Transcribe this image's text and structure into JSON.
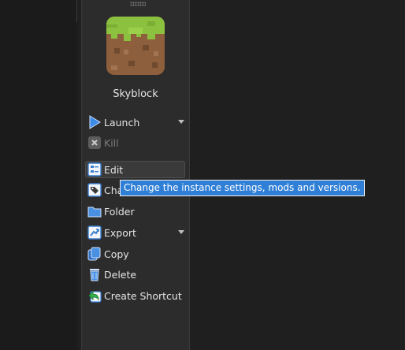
{
  "instance": {
    "name": "Skyblock",
    "icon": "grass-block-icon"
  },
  "menu": [
    {
      "key": "launch",
      "label": "Launch",
      "icon": "play-icon",
      "has_dropdown": true,
      "disabled": false
    },
    {
      "key": "kill",
      "label": "Kill",
      "icon": "kill-icon",
      "has_dropdown": false,
      "disabled": true
    },
    {
      "key": "edit",
      "label": "Edit",
      "icon": "edit-icon",
      "has_dropdown": false,
      "disabled": false,
      "hovered": true
    },
    {
      "key": "change_group",
      "label": "Cha",
      "icon": "tag-icon",
      "has_dropdown": false,
      "disabled": false
    },
    {
      "key": "folder",
      "label": "Folder",
      "icon": "folder-icon",
      "has_dropdown": false,
      "disabled": false
    },
    {
      "key": "export",
      "label": "Export",
      "icon": "export-icon",
      "has_dropdown": true,
      "disabled": false
    },
    {
      "key": "copy",
      "label": "Copy",
      "icon": "copy-icon",
      "has_dropdown": false,
      "disabled": false
    },
    {
      "key": "delete",
      "label": "Delete",
      "icon": "delete-icon",
      "has_dropdown": false,
      "disabled": false
    },
    {
      "key": "shortcut",
      "label": "Create Shortcut",
      "icon": "shortcut-icon",
      "has_dropdown": false,
      "disabled": false
    }
  ],
  "tooltip": {
    "text": "Change the instance settings, mods and versions."
  },
  "colors": {
    "accent": "#2f7fd6",
    "sidebar": "#2c2c2c",
    "background": "#1f1f1f"
  }
}
